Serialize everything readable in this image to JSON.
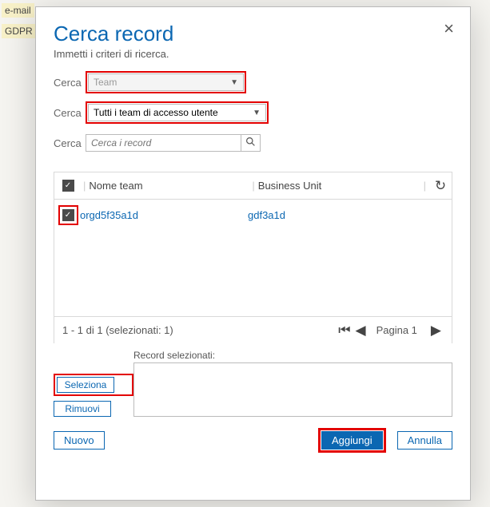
{
  "background": {
    "line1": "e-mail",
    "line2": "GDPR r"
  },
  "modal": {
    "title": "Cerca record",
    "subtitle": "Immetti i criteri di ricerca.",
    "close_glyph": "×",
    "rows": {
      "label1": "Cerca",
      "label2": "Cerca",
      "label3": "Cerca",
      "entity_placeholder": "Team",
      "view_value": "Tutti i team di accesso utente",
      "search_placeholder": "Cerca i record"
    },
    "table": {
      "col_name": "Nome team",
      "col_bu": "Business Unit",
      "rows": [
        {
          "name": "orgd5f35a1d",
          "bu": "gdf3a1d"
        }
      ]
    },
    "pager": {
      "count_text": "1 - 1 di 1 (selezionati: 1)",
      "page_label": "Pagina 1"
    },
    "selected": {
      "label": "Record selezionati:",
      "select_btn": "Seleziona",
      "remove_btn": "Rimuovi"
    },
    "footer": {
      "new_btn": "Nuovo",
      "add_btn": "Aggiungi",
      "cancel_btn": "Annulla"
    }
  }
}
